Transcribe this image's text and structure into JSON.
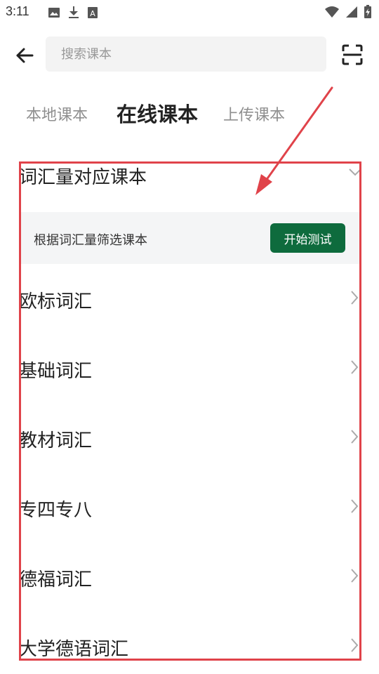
{
  "status_bar": {
    "time": "3:11",
    "left_icons": [
      "image-icon",
      "download-icon",
      "app-a-icon"
    ],
    "right_icons": [
      "wifi-icon",
      "signal-icon",
      "battery-icon"
    ]
  },
  "search": {
    "placeholder": "搜索课本",
    "value": ""
  },
  "tabs": [
    {
      "label": "本地课本",
      "active": false
    },
    {
      "label": "在线课本",
      "active": true
    },
    {
      "label": "上传课本",
      "active": false
    }
  ],
  "section": {
    "title": "词汇量对应课本",
    "filter_text": "根据词汇量筛选课本",
    "button_label": "开始测试"
  },
  "categories": [
    {
      "label": "欧标词汇"
    },
    {
      "label": "基础词汇"
    },
    {
      "label": "教材词汇"
    },
    {
      "label": "专四专八"
    },
    {
      "label": "德福词汇"
    },
    {
      "label": "大学德语词汇"
    }
  ],
  "colors": {
    "accent_green": "#0e6b3d",
    "annotation_red": "#e0434a",
    "card_bg": "#f4f5f6",
    "search_bg": "#f3f3f3"
  }
}
